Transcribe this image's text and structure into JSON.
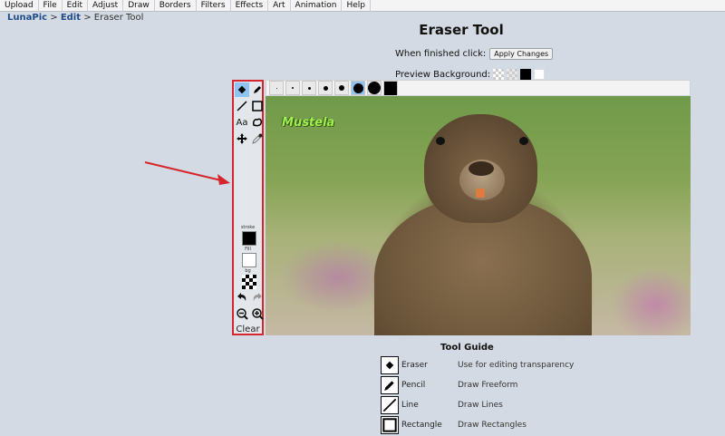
{
  "menu": [
    "Upload",
    "File",
    "Edit",
    "Adjust",
    "Draw",
    "Borders",
    "Filters",
    "Effects",
    "Art",
    "Animation",
    "Help"
  ],
  "breadcrumb": {
    "home": "LunaPic",
    "section": "Edit",
    "sep": ">",
    "current": "Eraser Tool"
  },
  "page": {
    "title": "Eraser Tool",
    "finished_label": "When finished click:",
    "apply_button": "Apply Changes",
    "preview_label": "Preview Background:"
  },
  "canvas": {
    "overlay_text": "Mustela"
  },
  "toolbox": {
    "stroke_label": "stroke",
    "fill_label": "Fill",
    "bg_label": "bg",
    "text_tool": "Aa",
    "clear_label": "Clear"
  },
  "colors": {
    "accent": "#d4262c",
    "selected": "#8fc3f3",
    "stroke": "#000000",
    "fill": "#ffffff"
  },
  "tool_guide": {
    "title": "Tool Guide",
    "rows": [
      {
        "name": "Eraser",
        "desc": "Use for editing transparency",
        "icon": "eraser-icon"
      },
      {
        "name": "Pencil",
        "desc": "Draw Freeform",
        "icon": "pencil-icon"
      },
      {
        "name": "Line",
        "desc": "Draw Lines",
        "icon": "line-icon"
      },
      {
        "name": "Rectangle",
        "desc": "Draw Rectangles",
        "icon": "rectangle-icon"
      }
    ]
  }
}
